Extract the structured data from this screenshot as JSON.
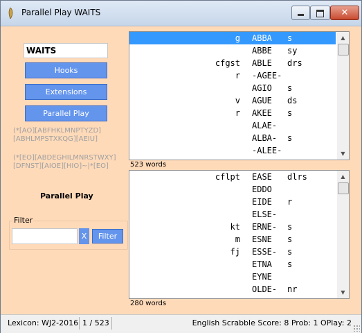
{
  "window": {
    "title": "Parallel Play WAITS"
  },
  "left": {
    "word": "WAITS",
    "hooks_label": "Hooks",
    "extensions_label": "Extensions",
    "parallel_play_label": "Parallel Play",
    "pattern1": "(*[AO][ABFHKLMNPTYZD]\n[ABHLMPSTXKQG][AEIU]",
    "pattern2": "(*[EO][ABDEGHILMNRSTWXY]\n[DFNST][AIOE][HIO]~|*[EO]",
    "mode_label": "Parallel Play",
    "filter": {
      "legend": "Filter",
      "value": "",
      "clear_label": "X",
      "button_label": "Filter"
    }
  },
  "list1": {
    "rows": [
      {
        "front": "g",
        "word": "ABBA",
        "back": "s",
        "selected": true
      },
      {
        "front": "",
        "word": "ABBE",
        "back": "sy"
      },
      {
        "front": "cfgst",
        "word": "ABLE",
        "back": "drs"
      },
      {
        "front": "r",
        "word": "-AGEE-",
        "back": ""
      },
      {
        "front": "",
        "word": "AGIO",
        "back": "s"
      },
      {
        "front": "v",
        "word": "AGUE",
        "back": "ds"
      },
      {
        "front": "r",
        "word": "AKEE",
        "back": "s"
      },
      {
        "front": "",
        "word": "ALAE-",
        "back": ""
      },
      {
        "front": "",
        "word": "ALBA-",
        "back": "s"
      },
      {
        "front": "",
        "word": "-ALEE-",
        "back": ""
      }
    ],
    "count": "523 words"
  },
  "list2": {
    "rows": [
      {
        "front": "cflpt",
        "word": "EASE",
        "back": "dlrs"
      },
      {
        "front": "",
        "word": "EDDO",
        "back": ""
      },
      {
        "front": "",
        "word": "EIDE",
        "back": "r"
      },
      {
        "front": "",
        "word": "ELSE-",
        "back": ""
      },
      {
        "front": "kt",
        "word": "ERNE-",
        "back": "s"
      },
      {
        "front": "m",
        "word": "ESNE",
        "back": "s"
      },
      {
        "front": "fj",
        "word": "ESSE-",
        "back": "s"
      },
      {
        "front": "",
        "word": "ETNA",
        "back": "s"
      },
      {
        "front": "",
        "word": "EYNE",
        "back": ""
      },
      {
        "front": "",
        "word": "OLDE-",
        "back": "nr"
      }
    ],
    "count": "280 words"
  },
  "status": {
    "lexicon": "Lexicon: WJ2-2016",
    "position": "1 / 523",
    "info": "English Scrabble Score: 8 Prob:  1 OPlay:  2"
  },
  "colors": {
    "background": "#ffdab9",
    "button": "#6495ed",
    "selection": "#3399ff"
  }
}
